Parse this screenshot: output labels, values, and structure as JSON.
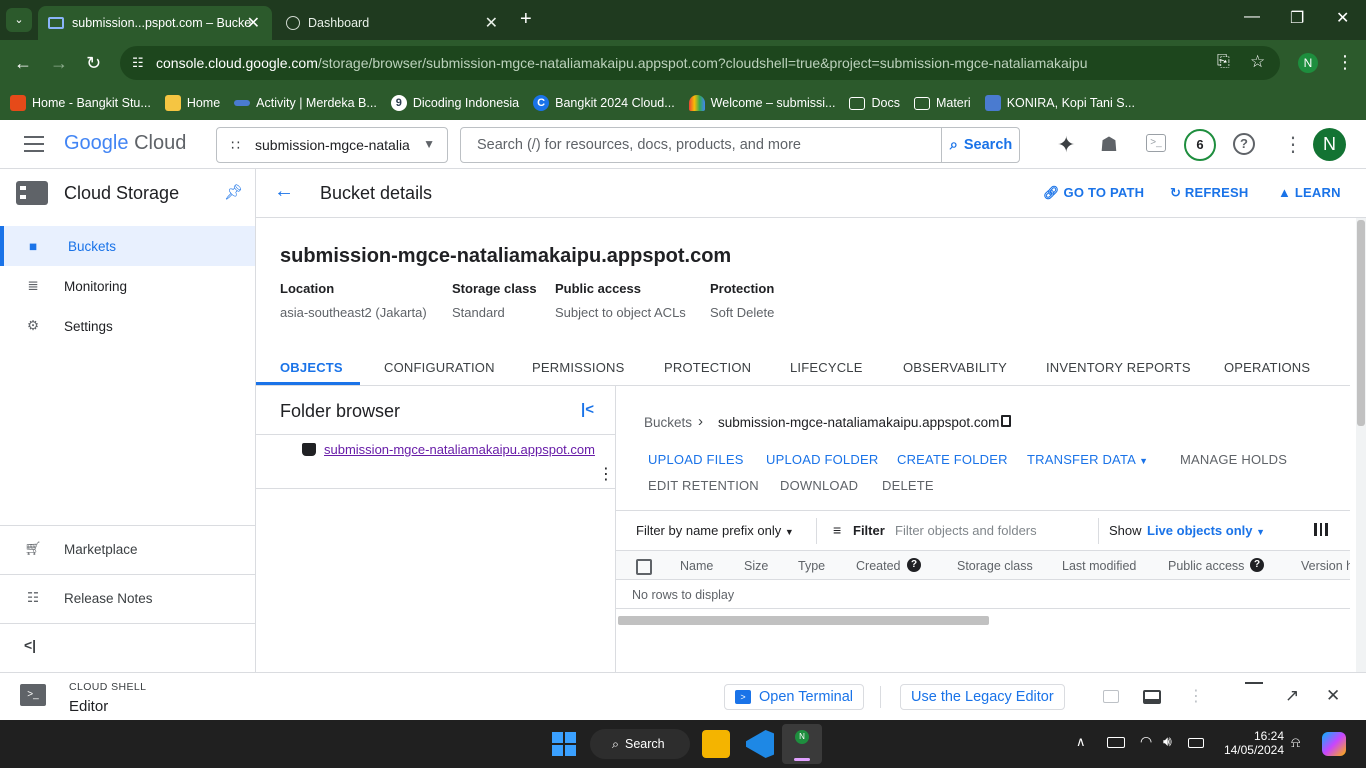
{
  "browser": {
    "tabs": [
      {
        "title": "submission...pspot.com – Bucke",
        "active": true
      },
      {
        "title": "Dashboard",
        "active": false
      }
    ],
    "url_host": "console.cloud.google.com",
    "url_path": "/storage/browser/submission-mgce-nataliamakaipu.appspot.com?cloudshell=true&project=submission-mgce-nataliamakaipu",
    "profile_initial": "N",
    "bookmarks": [
      {
        "label": "Home - Bangkit Stu...",
        "color": "#ff6b4a"
      },
      {
        "label": "Home",
        "color": "#f5c542"
      },
      {
        "label": "Activity | Merdeka B...",
        "color": "#4a7bd0"
      },
      {
        "label": "Dicoding Indonesia",
        "color": "#2d3e50"
      },
      {
        "label": "Bangkit 2024 Cloud...",
        "color": "#1a73e8"
      },
      {
        "label": "Welcome – submissi...",
        "color": "#ea4335"
      },
      {
        "label": "Docs",
        "color": "folder"
      },
      {
        "label": "Materi",
        "color": "folder"
      },
      {
        "label": "KONIRA, Kopi Tani S...",
        "color": "#4a7bd0"
      }
    ]
  },
  "gc_header": {
    "logo_google": "Google",
    "logo_cloud": "Cloud",
    "project": "submission-mgce-natalia",
    "search_placeholder": "Search (/) for resources, docs, products, and more",
    "search_button": "Search",
    "notifications": "6",
    "avatar": "N"
  },
  "sidebar": {
    "product": "Cloud Storage",
    "items": [
      {
        "label": "Buckets",
        "icon": "bucket-icon",
        "active": true
      },
      {
        "label": "Monitoring",
        "icon": "monitoring-icon"
      },
      {
        "label": "Settings",
        "icon": "gear-icon"
      }
    ],
    "bottom": [
      {
        "label": "Marketplace",
        "icon": "cart-icon"
      },
      {
        "label": "Release Notes",
        "icon": "notes-icon"
      }
    ]
  },
  "page": {
    "title": "Bucket details",
    "actions": [
      "GO TO PATH",
      "REFRESH",
      "LEARN"
    ],
    "bucket_name": "submission-mgce-nataliamakaipu.appspot.com",
    "meta": [
      {
        "label": "Location",
        "value": "asia-southeast2 (Jakarta)"
      },
      {
        "label": "Storage class",
        "value": "Standard"
      },
      {
        "label": "Public access",
        "value": "Subject to object ACLs"
      },
      {
        "label": "Protection",
        "value": "Soft Delete"
      }
    ],
    "tabs": [
      "OBJECTS",
      "CONFIGURATION",
      "PERMISSIONS",
      "PROTECTION",
      "LIFECYCLE",
      "OBSERVABILITY",
      "INVENTORY REPORTS",
      "OPERATIONS"
    ]
  },
  "folder_browser": {
    "title": "Folder browser",
    "item": "submission-mgce-nataliamakaipu.appspot.com"
  },
  "objects": {
    "breadcrumb_root": "Buckets",
    "breadcrumb_current": "submission-mgce-nataliamakaipu.appspot.com",
    "buttons_row1": [
      "UPLOAD FILES",
      "UPLOAD FOLDER",
      "CREATE FOLDER",
      "TRANSFER DATA",
      "MANAGE HOLDS"
    ],
    "buttons_row2": [
      "EDIT RETENTION",
      "DOWNLOAD",
      "DELETE"
    ],
    "filter_mode": "Filter by name prefix only",
    "filter_label": "Filter",
    "filter_placeholder": "Filter objects and folders",
    "show_label": "Show",
    "show_value": "Live objects only",
    "columns": [
      "Name",
      "Size",
      "Type",
      "Created",
      "Storage class",
      "Last modified",
      "Public access",
      "Version h"
    ],
    "empty": "No rows to display"
  },
  "cloud_shell": {
    "label": "CLOUD SHELL",
    "mode": "Editor",
    "open_terminal": "Open Terminal",
    "legacy": "Use the Legacy Editor"
  },
  "taskbar": {
    "search": "Search",
    "time": "16:24",
    "date": "14/05/2024"
  }
}
